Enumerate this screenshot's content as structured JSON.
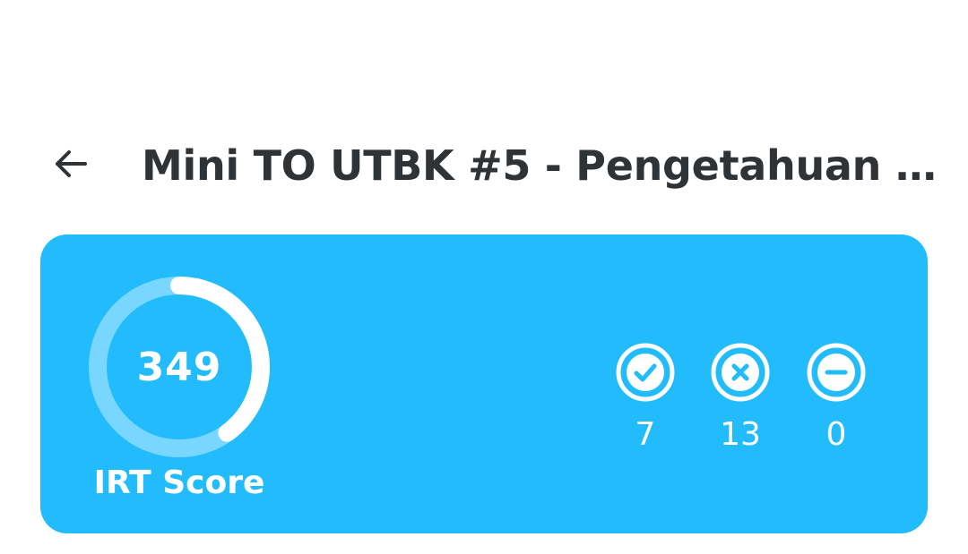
{
  "header": {
    "title": "Mini TO UTBK #5 - Pengetahuan K...",
    "back_icon": "arrow-left-icon"
  },
  "score_card": {
    "background_color": "#22bcfd",
    "ring_track_color": "#79d6fe",
    "ring_progress_color": "#ffffff",
    "irt_score": "349",
    "progress_fraction": 0.4,
    "label": "IRT Score",
    "stats": {
      "correct": {
        "icon": "check-circle-icon",
        "count": "7"
      },
      "wrong": {
        "icon": "x-circle-icon",
        "count": "13"
      },
      "empty": {
        "icon": "minus-circle-icon",
        "count": "0"
      }
    }
  }
}
